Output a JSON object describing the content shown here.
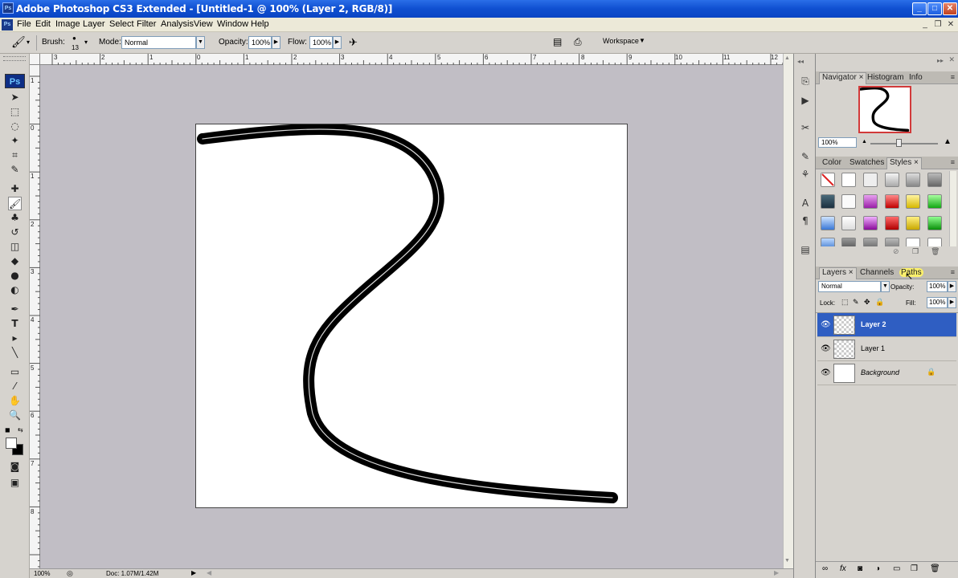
{
  "window": {
    "title": "Adobe Photoshop CS3 Extended - [Untitled-1 @ 100% (Layer 2, RGB/8)]",
    "app_icon": "Ps"
  },
  "menubar": {
    "items": [
      "File",
      "Edit",
      "Image",
      "Layer",
      "Select",
      "Filter",
      "Analysis",
      "View",
      "Window",
      "Help"
    ]
  },
  "options_bar": {
    "brush_label": "Brush:",
    "brush_size": "13",
    "mode_label": "Mode:",
    "mode_value": "Normal",
    "opacity_label": "Opacity:",
    "opacity_value": "100%",
    "flow_label": "Flow:",
    "flow_value": "100%",
    "workspace_label": "Workspace"
  },
  "toolbox": {
    "logo": "Ps"
  },
  "ruler_top": [
    "3",
    "2",
    "1",
    "0",
    "1",
    "2",
    "3",
    "4",
    "5",
    "6",
    "7",
    "8",
    "9",
    "10",
    "11",
    "12"
  ],
  "ruler_left": [
    "1",
    "0",
    "1",
    "2",
    "3",
    "4",
    "5",
    "6",
    "7",
    "8"
  ],
  "status": {
    "zoom": "100%",
    "doc": "Doc: 1.07M/1.42M"
  },
  "navigator": {
    "tabs": [
      "Navigator",
      "Histogram",
      "Info"
    ],
    "zoom": "100%"
  },
  "color_panel": {
    "tabs": [
      "Color",
      "Swatches",
      "Styles"
    ]
  },
  "layers_panel": {
    "tabs": [
      "Layers",
      "Channels",
      "Paths"
    ],
    "blend_mode": "Normal",
    "opacity_label": "Opacity:",
    "opacity_value": "100%",
    "lock_label": "Lock:",
    "fill_label": "Fill:",
    "fill_value": "100%",
    "layers": [
      {
        "name": "Layer 2",
        "selected": true
      },
      {
        "name": "Layer 1",
        "selected": false
      },
      {
        "name": "Background",
        "selected": false,
        "locked": true
      }
    ]
  },
  "colors": {
    "titlebar": "#0f4fd0",
    "selection": "#2f5ec2",
    "workspace": "#c1bec5"
  }
}
